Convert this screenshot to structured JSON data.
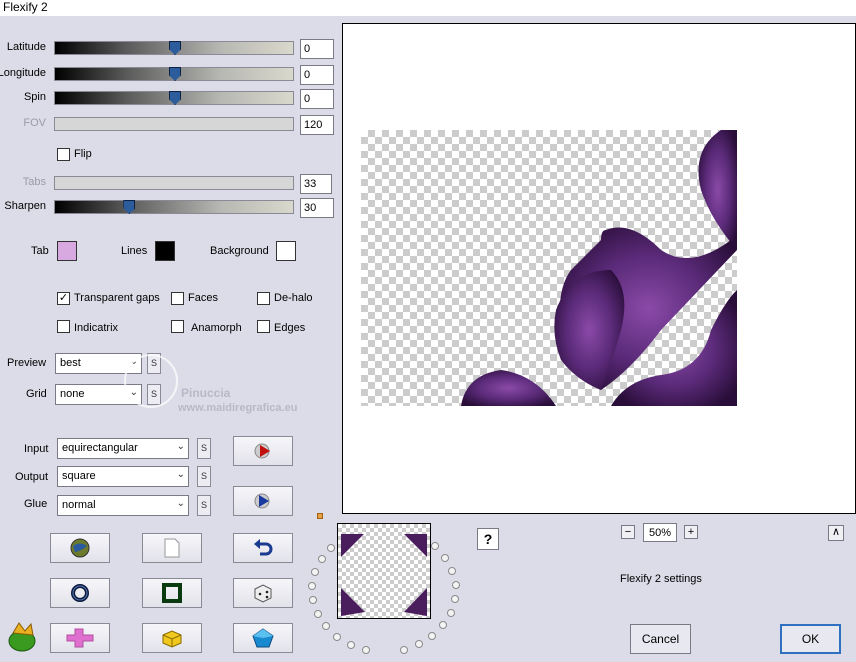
{
  "window": {
    "title": "Flexify 2"
  },
  "sliders": [
    {
      "label": "Latitude",
      "value": "0",
      "level": 0.5,
      "enabled": true
    },
    {
      "label": "Longitude",
      "value": "0",
      "level": 0.5,
      "enabled": true
    },
    {
      "label": "Spin",
      "value": "0",
      "level": 0.5,
      "enabled": true
    },
    {
      "label": "FOV",
      "value": "120",
      "enabled": false
    },
    {
      "label": "Tabs",
      "value": "33",
      "enabled": false
    },
    {
      "label": "Sharpen",
      "value": "30",
      "level": 0.3,
      "enabled": true
    }
  ],
  "flip": {
    "label": "Flip",
    "checked": false
  },
  "colors": {
    "tab_label": "Tab",
    "tab_color": "#d8a8e0",
    "lines_label": "Lines",
    "lines_color": "#000000",
    "background_label": "Background",
    "background_color": "#ffffff"
  },
  "options": {
    "transparent_gaps": {
      "label": "Transparent gaps",
      "checked": true
    },
    "faces": {
      "label": "Faces",
      "checked": false
    },
    "de_halo": {
      "label": "De-halo",
      "checked": false
    },
    "indicatrix": {
      "label": "Indicatrix",
      "checked": false
    },
    "anamorph": {
      "label": "Anamorph",
      "checked": false
    },
    "edges": {
      "label": "Edges",
      "checked": false
    }
  },
  "preview": {
    "label": "Preview",
    "value": "best"
  },
  "grid": {
    "label": "Grid",
    "value": "none"
  },
  "input": {
    "label": "Input",
    "value": "equirectangular"
  },
  "output": {
    "label": "Output",
    "value": "square"
  },
  "glue": {
    "label": "Glue",
    "value": "normal"
  },
  "s_label": "S",
  "watermark": {
    "line1": "Pinuccia",
    "line2": "www.maidiregrafica.eu"
  },
  "zoom": {
    "value": "50%",
    "minus": "−",
    "plus": "+"
  },
  "help": "?",
  "collapse": "∧",
  "status": "Flexify 2 settings",
  "buttons": {
    "cancel": "Cancel",
    "ok": "OK"
  },
  "icons": {
    "render": "render-play-icon",
    "morph": "morph-play-icon",
    "globe": "globe-icon",
    "page": "blank-page-icon",
    "undo": "undo-arrow-icon",
    "ring": "ring-icon",
    "square": "square-frame-icon",
    "dice": "dice-icon",
    "plugin": "plugin-logo-icon",
    "cross": "cross-shape-icon",
    "cube": "cube-icon",
    "pentagon": "pentagon-icon"
  }
}
